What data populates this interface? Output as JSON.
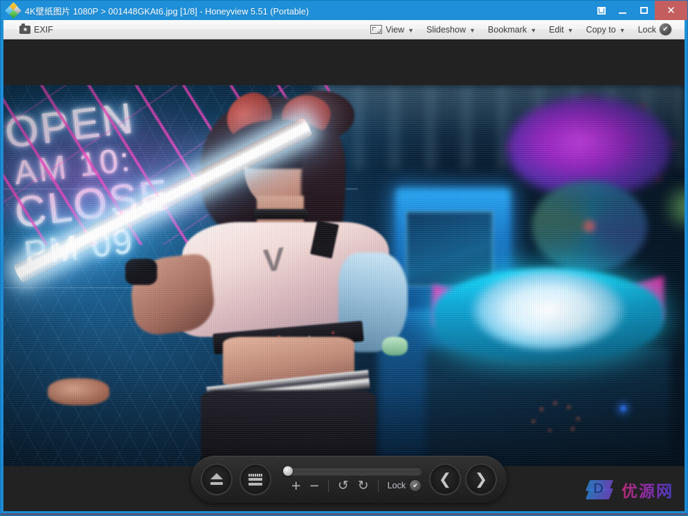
{
  "window": {
    "title": "4K壁纸图片 1080P > 001448GKAt6.jpg [1/8] - Honeyview 5.51 (Portable)",
    "logo_icon": "honeyview-diamond-logo",
    "buttons": {
      "fullscreen": "⛶",
      "fullscreen_icon": "fullscreen-icon",
      "minimize": "",
      "minimize_icon": "minimize-icon",
      "maximize": "",
      "maximize_icon": "maximize-icon",
      "close": "✕",
      "close_icon": "close-icon"
    },
    "accent_color": "#1d8ad4",
    "close_color": "#c45d5d"
  },
  "toolbar": {
    "exif_label": "EXIF",
    "exif_icon": "camera-icon",
    "items": [
      {
        "label": "View",
        "icon": "fit-screen-icon",
        "caret": "▼"
      },
      {
        "label": "Slideshow",
        "icon": "",
        "caret": "▼"
      },
      {
        "label": "Bookmark",
        "icon": "",
        "caret": "▼"
      },
      {
        "label": "Edit",
        "icon": "",
        "caret": "▼"
      },
      {
        "label": "Copy to",
        "icon": "",
        "caret": "▼"
      }
    ],
    "lock_label": "Lock",
    "lock_badge": "✔",
    "lock_badge_icon": "check-circle-icon"
  },
  "photo": {
    "alt": "Cosplay model holding a glowing neon tube in a blue-lit arcade",
    "neon_sign": {
      "line1": "OPEN",
      "line2": "AM 10:",
      "line3": "CLOSE",
      "line4": "PM 09"
    },
    "shirt_logo": "V",
    "colors": {
      "ambient_blue": "#1a6fa8",
      "neon_pink": "#ff2bb0",
      "neon_cyan": "#18e0ff",
      "neon_purple": "#a72ad8"
    }
  },
  "controlbar": {
    "eject_icon": "eject-icon",
    "menu_icon": "hamburger-menu-icon",
    "slider_value": 0,
    "zoom_in": "+",
    "zoom_in_icon": "plus-icon",
    "zoom_out": "−",
    "zoom_out_icon": "minus-icon",
    "rotate_ccw": "↺",
    "rotate_ccw_icon": "rotate-left-icon",
    "rotate_cw": "↻",
    "rotate_cw_icon": "rotate-right-icon",
    "lock_label": "Lock",
    "lock_badge": "✔",
    "prev": "❮",
    "prev_icon": "chevron-left-icon",
    "next": "❯",
    "next_icon": "chevron-right-icon"
  },
  "watermark": {
    "logo_letter": "D",
    "text": "优源网"
  }
}
